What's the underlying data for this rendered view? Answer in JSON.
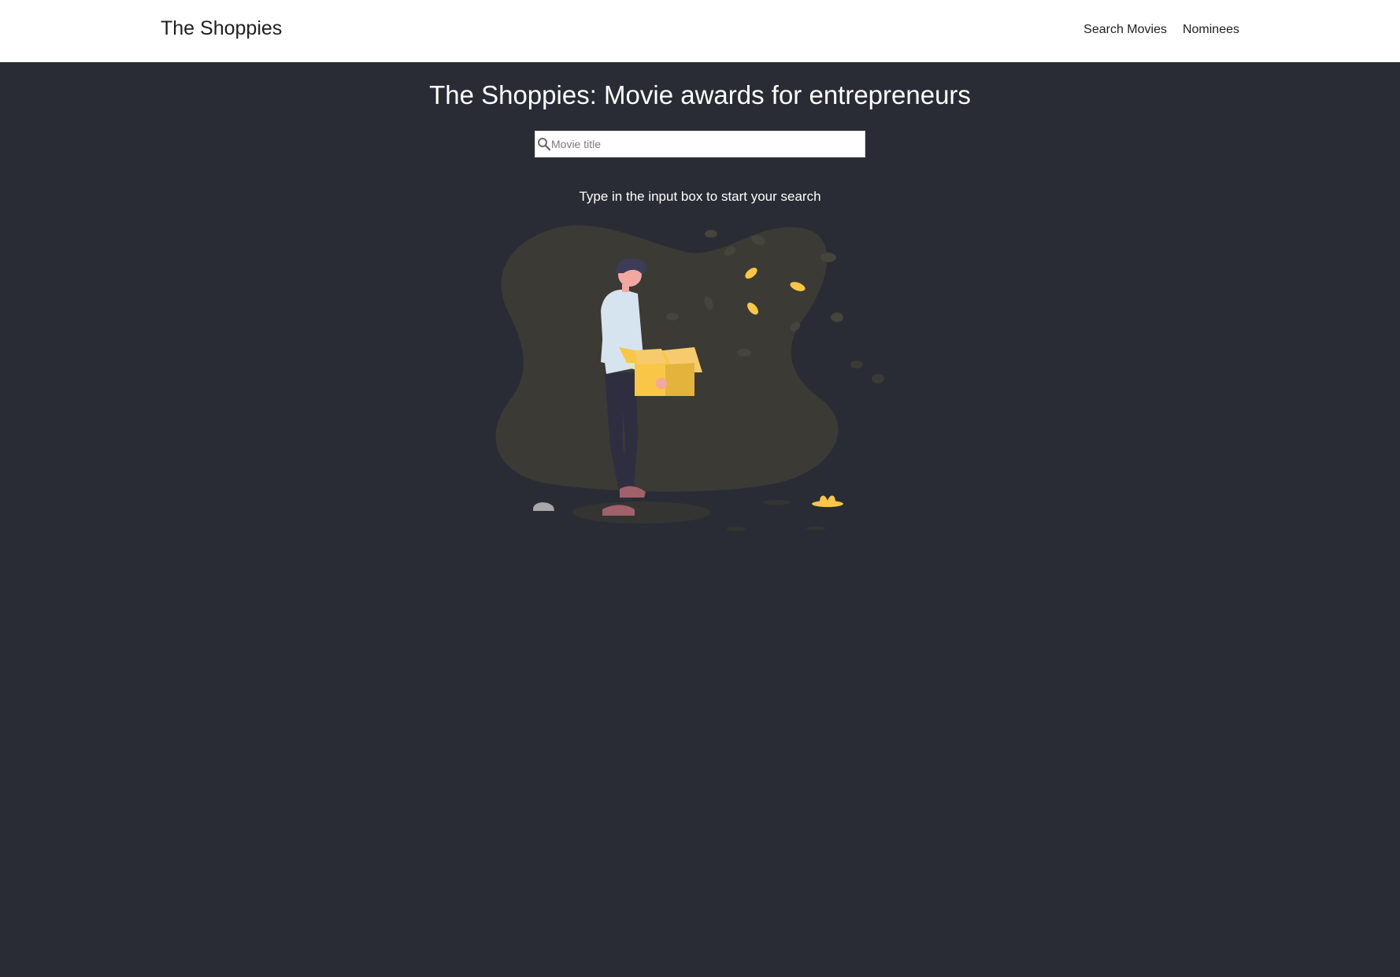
{
  "navbar": {
    "brand": "The Shoppies",
    "links": [
      {
        "label": "Search Movies"
      },
      {
        "label": "Nominees"
      }
    ]
  },
  "main": {
    "title": "The Shoppies: Movie awards for entrepreneurs",
    "search": {
      "placeholder": "Movie title",
      "value": ""
    },
    "hint": "Type in the input box to start your search"
  },
  "colors": {
    "background": "#292c34",
    "navbar": "#ffffff",
    "accent": "#f9c646"
  },
  "icons": {
    "search": "search-icon"
  }
}
